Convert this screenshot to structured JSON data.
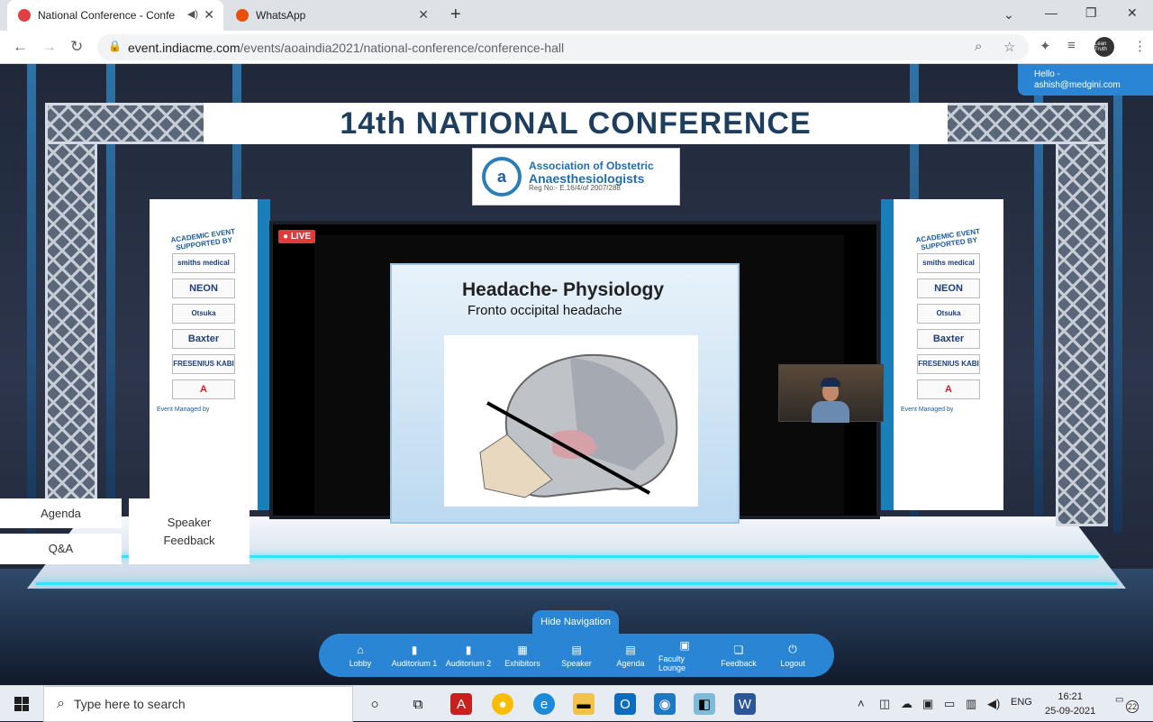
{
  "browser": {
    "tabs": [
      {
        "title": "National Conference - Confe",
        "active": true
      },
      {
        "title": "WhatsApp",
        "active": false
      }
    ],
    "url_host": "event.indiacme.com",
    "url_path": "/events/aoaindia2021/national-conference/conference-hall",
    "profile_label": "Lean Truth"
  },
  "hello": {
    "greeting": "Hello -",
    "email": "ashish@medgini.com"
  },
  "stage": {
    "title": "14th NATIONAL CONFERENCE",
    "assoc_line1": "Association of Obstetric",
    "assoc_line2": "Anaesthesiologists",
    "assoc_reg": "Reg No:- E.16/4/of 2007/288",
    "assoc_logo": "a",
    "sponsor_heading": "ACADEMIC EVENT SUPPORTED BY",
    "sponsors": [
      "smiths medical",
      "NEON",
      "Otsuka",
      "Baxter",
      "FRESENIUS KABI",
      "A"
    ],
    "managed_by": "Event Managed by",
    "phone": "+91 96402 72040"
  },
  "screen": {
    "live": "LIVE",
    "slide_title": "Headache- Physiology",
    "slide_subtitle": "Fronto occipital headache"
  },
  "side_buttons": {
    "agenda": "Agenda",
    "qa": "Q&A",
    "speaker_feedback_1": "Speaker",
    "speaker_feedback_2": "Feedback"
  },
  "nav": {
    "hide": "Hide Navigation",
    "items": [
      {
        "label": "Lobby",
        "icon": "home-icon"
      },
      {
        "label": "Auditorium 1",
        "icon": "door-icon"
      },
      {
        "label": "Auditorium 2",
        "icon": "door-icon"
      },
      {
        "label": "Exhibitors",
        "icon": "grid-icon"
      },
      {
        "label": "Speaker",
        "icon": "document-icon"
      },
      {
        "label": "Agenda",
        "icon": "document-icon"
      },
      {
        "label": "Faculty Lounge",
        "icon": "lounge-icon"
      },
      {
        "label": "Feedback",
        "icon": "feedback-icon"
      },
      {
        "label": "Logout",
        "icon": "power-icon"
      }
    ]
  },
  "taskbar": {
    "search_placeholder": "Type here to search",
    "lang": "ENG",
    "time": "16:21",
    "date": "25-09-2021",
    "notif_count": "22"
  }
}
